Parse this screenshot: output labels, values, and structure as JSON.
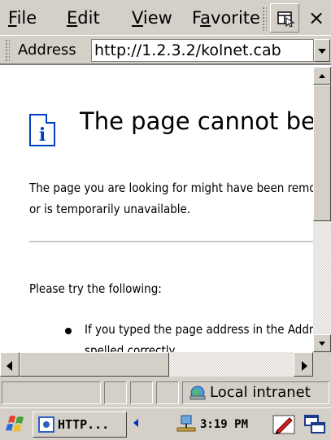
{
  "menubar": {
    "items": [
      {
        "accel": "F",
        "rest": "ile"
      },
      {
        "accel": "E",
        "rest": "dit"
      },
      {
        "accel": "V",
        "rest": "iew"
      },
      {
        "pre": "F",
        "accel": "a",
        "rest": "vorite"
      }
    ],
    "toolbar_icon": "view-toggle-icon",
    "close_label": "×"
  },
  "address": {
    "label": "Address",
    "value": "http://1.2.3.2/kolnet.cab"
  },
  "page": {
    "icon": "info-page-icon",
    "icon_glyph": "i",
    "title": "The page cannot be found",
    "message_line1": "The page you are looking for might have been removed, had its name changed,",
    "message_line2": "or is temporarily unavailable.",
    "try_heading": "Please try the following:",
    "bullet1_line1": "If you typed the page address in the Address bar, make sure that it is",
    "bullet1_line2": "spelled correctly."
  },
  "status": {
    "zone_icon": "intranet-icon",
    "zone_label": "Local intranet"
  },
  "taskbar": {
    "start_icon": "windows-flag-icon",
    "task_label": "HTTP...",
    "tray_icons": [
      "scroll-left-icon",
      "network-icon",
      "pen-input-icon",
      "show-desktop-icon"
    ],
    "time": "3:19 PM"
  },
  "colors": {
    "chrome": "#d4d0c8",
    "info_blue": "#0040c0"
  }
}
